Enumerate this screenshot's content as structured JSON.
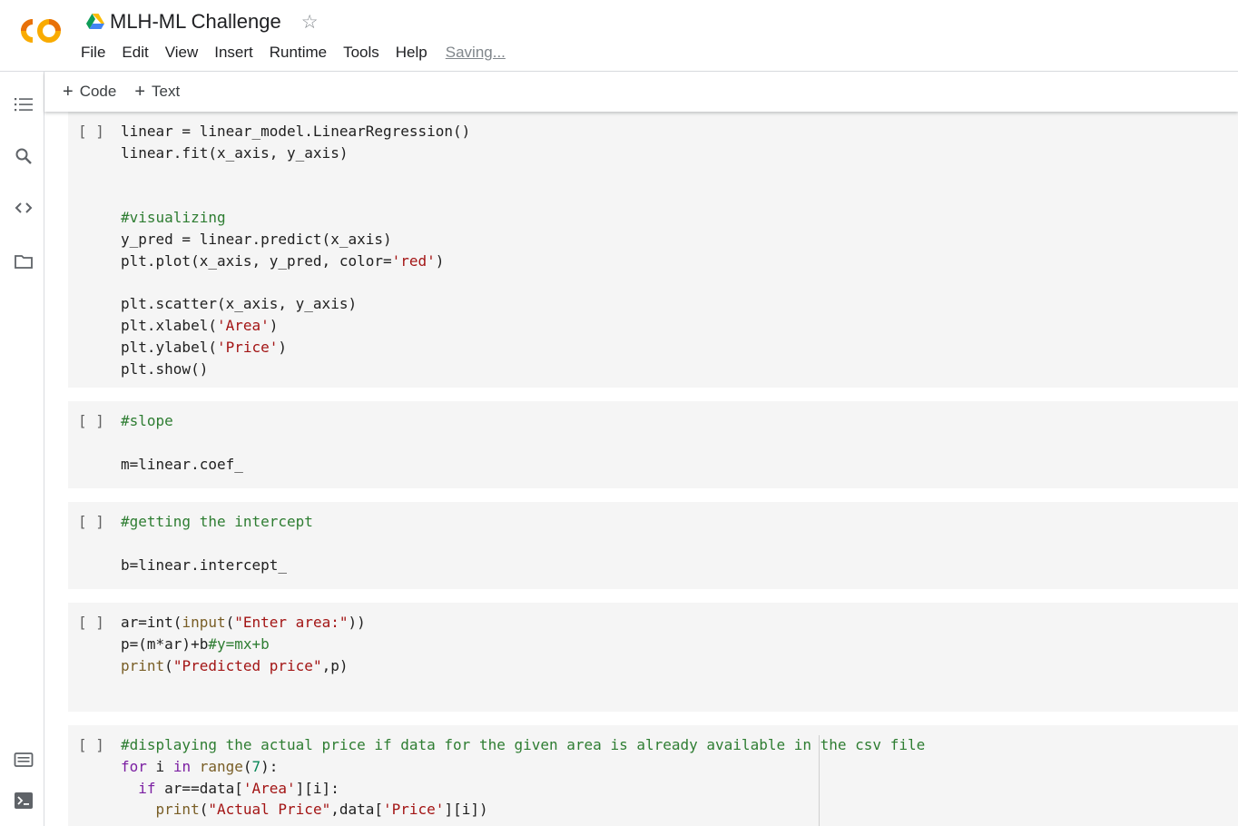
{
  "header": {
    "title": "MLH-ML Challenge",
    "star_glyph": "☆",
    "menu": [
      "File",
      "Edit",
      "View",
      "Insert",
      "Runtime",
      "Tools",
      "Help"
    ],
    "status": "Saving..."
  },
  "toolbar": {
    "code_label": "Code",
    "text_label": "Text"
  },
  "sidebar": {
    "icons": [
      "toc-icon",
      "search-icon",
      "code-snippets-icon",
      "folder-icon",
      "command-palette-icon",
      "terminal-icon"
    ]
  },
  "cells": {
    "bracket": "[ ]",
    "c1": {
      "l1": "linear = linear_model.LinearRegression()",
      "l2": "linear.fit(x_axis, y_axis)",
      "l3": "#visualizing",
      "l4": "y_pred = linear.predict(x_axis)",
      "l5a": "plt.plot(x_axis, y_pred, color=",
      "l5b": "'red'",
      "l5c": ")",
      "l6": "plt.scatter(x_axis, y_axis)",
      "l7a": "plt.xlabel(",
      "l7b": "'Area'",
      "l7c": ")",
      "l8a": "plt.ylabel(",
      "l8b": "'Price'",
      "l8c": ")",
      "l9": "plt.show()"
    },
    "c2": {
      "l1": "#slope",
      "l2": "m=linear.coef_"
    },
    "c3": {
      "l1": "#getting the intercept",
      "l2": "b=linear.intercept_"
    },
    "c4": {
      "l1a": "ar=int(",
      "l1b": "input",
      "l1c": "(",
      "l1d": "\"Enter area:\"",
      "l1e": "))",
      "l2a": "p=(m*ar)+b",
      "l2b": "#y=mx+b",
      "l3a": "print",
      "l3b": "(",
      "l3c": "\"Predicted price\"",
      "l3d": ",p)"
    },
    "c5": {
      "l1": "#displaying the actual price if data for the given area is already available in the csv file",
      "l2a": "for",
      "l2b": " i ",
      "l2c": "in",
      "l2d": " ",
      "l2e": "range",
      "l2f": "(",
      "l2g": "7",
      "l2h": "):",
      "l3a": "  ",
      "l3b": "if",
      "l3c": " ar==data[",
      "l3d": "'Area'",
      "l3e": "][i]:",
      "l4a": "    ",
      "l4b": "print",
      "l4c": "(",
      "l4d": "\"Actual Price\"",
      "l4e": ",data[",
      "l4f": "'Price'",
      "l4g": "][i])"
    }
  }
}
